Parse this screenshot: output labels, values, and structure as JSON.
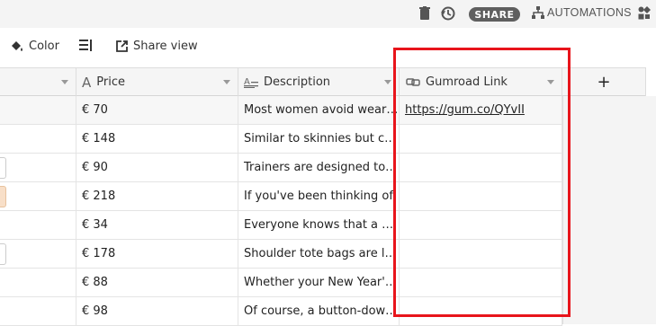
{
  "topbar": {
    "share_label": "SHARE",
    "automations_label": "AUTOMATIONS",
    "icons": [
      "trash-icon",
      "history-icon",
      "automations-icon",
      "apps-icon"
    ]
  },
  "toolbar": {
    "color_label": "Color",
    "share_view_label": "Share view",
    "icons": [
      "paint-bucket-icon",
      "row-height-icon",
      "share-view-icon"
    ]
  },
  "columns": [
    {
      "label": "Price",
      "icon": "text-a-icon"
    },
    {
      "label": "Description",
      "icon": "long-text-icon"
    },
    {
      "label": "Gumroad Link",
      "icon": "url-link-icon"
    }
  ],
  "add_column_label": "+",
  "rows": [
    {
      "price": "€ 70",
      "description": "Most women avoid wearing",
      "link": "https://gum.co/QYvII"
    },
    {
      "price": "€ 148",
      "description": "Similar to skinnies but crop",
      "link": ""
    },
    {
      "price": "€ 90",
      "description": "Trainers are designed to be",
      "link": ""
    },
    {
      "price": "€ 218",
      "description": "If you've been thinking of",
      "link": ""
    },
    {
      "price": "€ 34",
      "description": "Everyone knows that a bag",
      "link": ""
    },
    {
      "price": "€ 178",
      "description": "Shoulder tote bags are large",
      "link": ""
    },
    {
      "price": "€ 88",
      "description": "Whether your New Year's res",
      "link": ""
    },
    {
      "price": "€ 98",
      "description": "Of course, a button-down sh",
      "link": ""
    }
  ],
  "colors": {
    "highlight": "#e8141b",
    "share_badge": "#5f5f5f"
  }
}
